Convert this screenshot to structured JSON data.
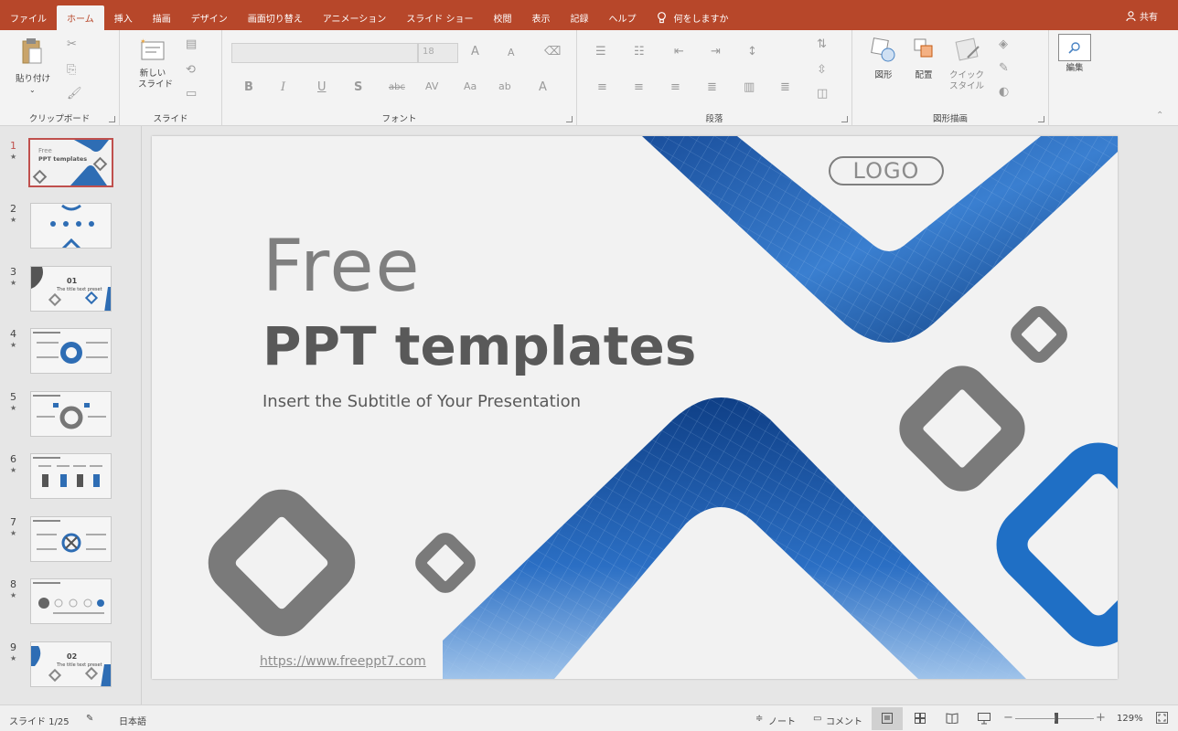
{
  "menubar": {
    "tabs": [
      "ファイル",
      "ホーム",
      "挿入",
      "描画",
      "デザイン",
      "画面切り替え",
      "アニメーション",
      "スライド ショー",
      "校閲",
      "表示",
      "記録",
      "ヘルプ"
    ],
    "tell_me": "何をしますか",
    "share": "共有"
  },
  "ribbon": {
    "clipboard": {
      "paste": "貼り付け",
      "label": "クリップボード"
    },
    "slides": {
      "new_slide_line1": "新しい",
      "new_slide_line2": "スライド",
      "label": "スライド"
    },
    "font": {
      "size": "18",
      "label": "フォント"
    },
    "paragraph": {
      "label": "段落"
    },
    "drawing": {
      "shapes": "図形",
      "arrange": "配置",
      "quick_styles_line1": "クイック",
      "quick_styles_line2": "スタイル",
      "label": "図形描画"
    },
    "editing": {
      "label": "編集"
    }
  },
  "thumbnails": [
    {
      "num": "1",
      "title_a": "Free",
      "title_b": "PPT templates"
    },
    {
      "num": "2"
    },
    {
      "num": "3",
      "heading": "01",
      "sub": "The title text preset"
    },
    {
      "num": "4"
    },
    {
      "num": "5"
    },
    {
      "num": "6"
    },
    {
      "num": "7"
    },
    {
      "num": "8"
    },
    {
      "num": "9",
      "heading": "02",
      "sub": "The title text preset"
    }
  ],
  "slide": {
    "title_line1": "Free",
    "title_line2": "PPT templates",
    "subtitle": "Insert the Subtitle of Your Presentation",
    "url": "https://www.freeppt7.com",
    "logo": "LOGO"
  },
  "status": {
    "slide_counter": "スライド 1/25",
    "language": "日本語",
    "notes": "ノート",
    "comments": "コメント",
    "zoom": "129%"
  },
  "colors": {
    "accent": "#b7472a",
    "slide_blue": "#1f6fc5",
    "slide_gray": "#7a7a7a"
  }
}
